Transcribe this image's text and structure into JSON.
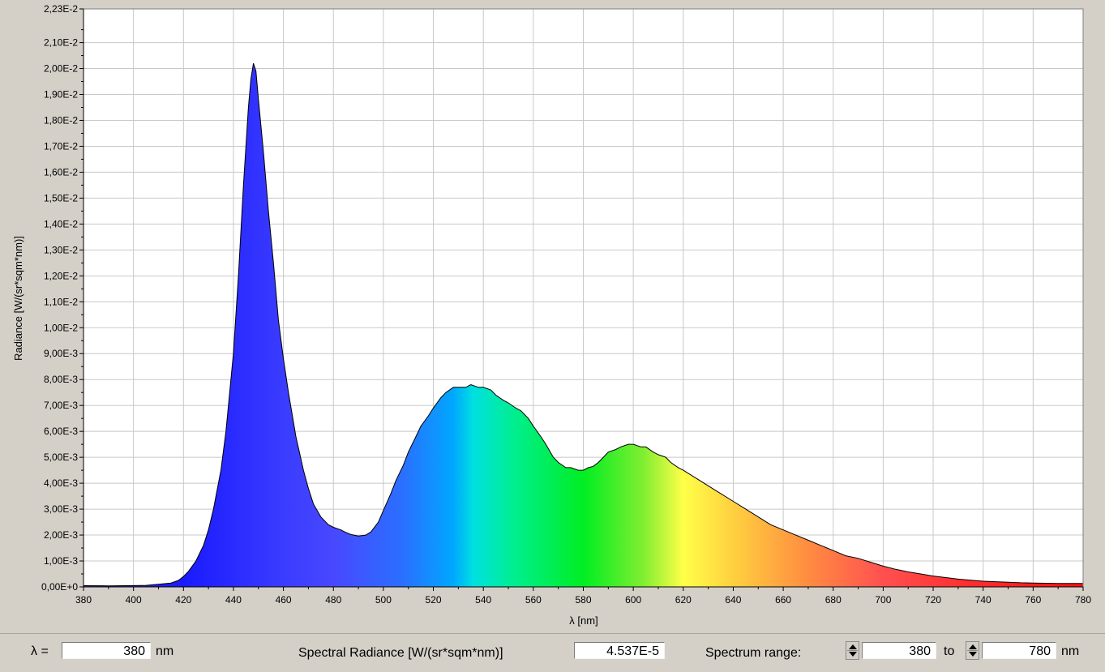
{
  "chart_data": {
    "type": "area",
    "title": "",
    "xlabel": "λ [nm]",
    "ylabel": "Radiance [W/(sr*sqm*nm)]",
    "xlim": [
      380,
      780
    ],
    "ylim": [
      0,
      0.0223
    ],
    "grid": true,
    "fill": "visible-spectrum gradient",
    "x_ticks": [
      380,
      400,
      420,
      440,
      460,
      480,
      500,
      520,
      540,
      560,
      580,
      600,
      620,
      640,
      660,
      680,
      700,
      720,
      740,
      760,
      780
    ],
    "y_ticks": [
      {
        "value": 0.0,
        "label": "0,00E+0"
      },
      {
        "value": 0.001,
        "label": "1,00E-3"
      },
      {
        "value": 0.002,
        "label": "2,00E-3"
      },
      {
        "value": 0.003,
        "label": "3,00E-3"
      },
      {
        "value": 0.004,
        "label": "4,00E-3"
      },
      {
        "value": 0.005,
        "label": "5,00E-3"
      },
      {
        "value": 0.006,
        "label": "6,00E-3"
      },
      {
        "value": 0.007,
        "label": "7,00E-3"
      },
      {
        "value": 0.008,
        "label": "8,00E-3"
      },
      {
        "value": 0.009,
        "label": "9,00E-3"
      },
      {
        "value": 0.01,
        "label": "1,00E-2"
      },
      {
        "value": 0.011,
        "label": "1,10E-2"
      },
      {
        "value": 0.012,
        "label": "1,20E-2"
      },
      {
        "value": 0.013,
        "label": "1,30E-2"
      },
      {
        "value": 0.014,
        "label": "1,40E-2"
      },
      {
        "value": 0.015,
        "label": "1,50E-2"
      },
      {
        "value": 0.016,
        "label": "1,60E-2"
      },
      {
        "value": 0.017,
        "label": "1,70E-2"
      },
      {
        "value": 0.018,
        "label": "1,80E-2"
      },
      {
        "value": 0.019,
        "label": "1,90E-2"
      },
      {
        "value": 0.02,
        "label": "2,00E-2"
      },
      {
        "value": 0.021,
        "label": "2,10E-2"
      },
      {
        "value": 0.0223,
        "label": "2,23E-2"
      }
    ],
    "series": [
      {
        "x": [
          380,
          390,
          400,
          405,
          410,
          415,
          418,
          420,
          422,
          425,
          428,
          430,
          432,
          435,
          437,
          440,
          442,
          444,
          446,
          447,
          448,
          449,
          450,
          452,
          454,
          456,
          458,
          460,
          462,
          465,
          468,
          470,
          472,
          475,
          478,
          480,
          483,
          485,
          487,
          490,
          493,
          495,
          498,
          500,
          503,
          505,
          508,
          510,
          513,
          515,
          518,
          520,
          523,
          525,
          528,
          530,
          533,
          535,
          538,
          540,
          543,
          545,
          548,
          550,
          553,
          555,
          558,
          560,
          563,
          565,
          568,
          570,
          573,
          575,
          578,
          580,
          582,
          584,
          586,
          588,
          590,
          593,
          595,
          598,
          600,
          603,
          605,
          608,
          610,
          613,
          615,
          618,
          620,
          625,
          630,
          635,
          640,
          645,
          650,
          655,
          660,
          665,
          670,
          675,
          680,
          685,
          690,
          695,
          700,
          705,
          710,
          715,
          720,
          725,
          730,
          735,
          740,
          745,
          750,
          755,
          760,
          765,
          770,
          775,
          780
        ],
        "y": [
          4.537e-05,
          4e-05,
          5e-05,
          6e-05,
          0.0001,
          0.00015,
          0.00025,
          0.0004,
          0.0006,
          0.001,
          0.0016,
          0.0022,
          0.003,
          0.0045,
          0.006,
          0.009,
          0.012,
          0.0155,
          0.0185,
          0.0196,
          0.0202,
          0.0199,
          0.0188,
          0.0168,
          0.0145,
          0.0125,
          0.0103,
          0.0088,
          0.0075,
          0.0058,
          0.0045,
          0.0038,
          0.0032,
          0.0027,
          0.0024,
          0.0023,
          0.0022,
          0.0021,
          0.00202,
          0.00196,
          0.002,
          0.00212,
          0.0025,
          0.00295,
          0.0036,
          0.0041,
          0.0047,
          0.0052,
          0.0058,
          0.0062,
          0.0066,
          0.0069,
          0.0073,
          0.0075,
          0.0077,
          0.0077,
          0.0077,
          0.0078,
          0.0077,
          0.0077,
          0.0076,
          0.0074,
          0.0072,
          0.0071,
          0.0069,
          0.0068,
          0.0065,
          0.0062,
          0.0058,
          0.0055,
          0.005,
          0.0048,
          0.0046,
          0.0046,
          0.0045,
          0.0045,
          0.0046,
          0.00465,
          0.0048,
          0.005,
          0.0052,
          0.0053,
          0.0054,
          0.0055,
          0.0055,
          0.0054,
          0.0054,
          0.0052,
          0.0051,
          0.005,
          0.0048,
          0.0046,
          0.0045,
          0.0042,
          0.0039,
          0.0036,
          0.0033,
          0.003,
          0.0027,
          0.0024,
          0.0022,
          0.002,
          0.0018,
          0.0016,
          0.0014,
          0.0012,
          0.0011,
          0.00095,
          0.0008,
          0.00068,
          0.00058,
          0.0005,
          0.00042,
          0.00036,
          0.0003,
          0.00026,
          0.00022,
          0.0002,
          0.00018,
          0.00016,
          0.00015,
          0.00014,
          0.00013,
          0.00013,
          0.00013
        ]
      }
    ]
  },
  "controls": {
    "lambda_label": "λ =",
    "lambda_value": "380",
    "lambda_unit": "nm",
    "radiance_label": "Spectral Radiance [W/(sr*sqm*nm)]",
    "radiance_value": "4.537E-5",
    "range_label": "Spectrum range:",
    "range_from": "380",
    "range_to_label": "to",
    "range_to": "780",
    "range_unit": "nm"
  }
}
